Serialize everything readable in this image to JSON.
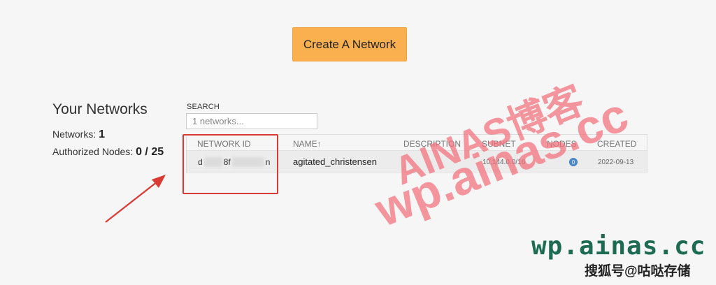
{
  "toolbar": {
    "create_label": "Create A Network"
  },
  "sidebar": {
    "title": "Your Networks",
    "networks_label": "Networks:",
    "networks_count": "1",
    "authorized_label": "Authorized Nodes:",
    "authorized_value": "0 / 25"
  },
  "search": {
    "label": "SEARCH",
    "placeholder": "1 networks..."
  },
  "table": {
    "headers": [
      "NETWORK ID",
      "NAME↑",
      "DESCRIPTION",
      "SUBNET",
      "NODES",
      "CREATED"
    ],
    "rows": [
      {
        "network_id_start": "d",
        "network_id_mid": "8f",
        "network_id_end": "n",
        "name": "agitated_christensen",
        "description": "",
        "subnet": "10.144.0.0/16",
        "nodes": "0",
        "created": "2022-09-13"
      }
    ]
  },
  "watermarks": {
    "line1": "AINAS博客",
    "line2": "wp.ainas.cc",
    "footer": "wp.ainas.cc",
    "footer_sub": "搜狐号@咕哒存储"
  },
  "colors": {
    "accent": "#fbb050",
    "highlight": "#d93a33",
    "badge": "#4a86c8",
    "watermark": "#f36e78"
  }
}
